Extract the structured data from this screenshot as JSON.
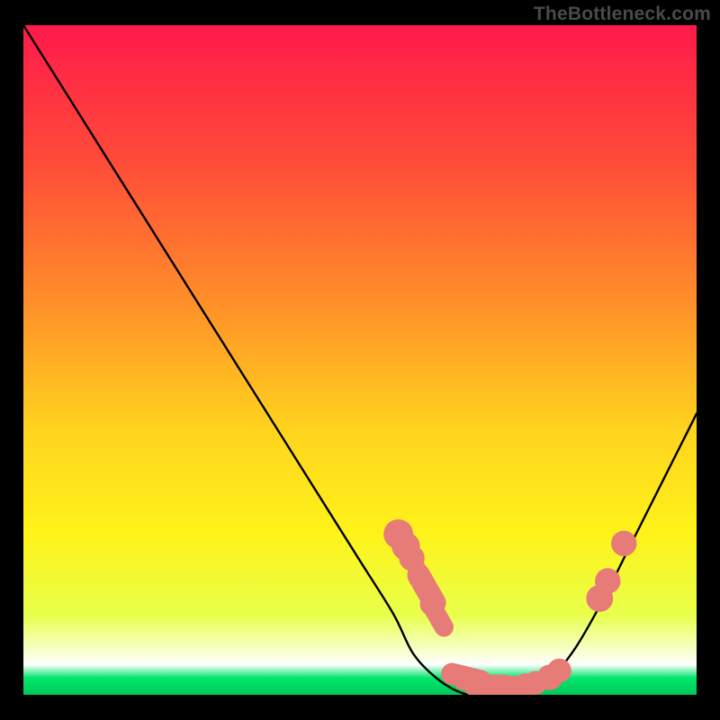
{
  "watermark": "TheBottleneck.com",
  "gradient": {
    "stops": [
      {
        "offset": 0.0,
        "color": "#ff1a4b"
      },
      {
        "offset": 0.2,
        "color": "#ff4a39"
      },
      {
        "offset": 0.4,
        "color": "#ff8a2a"
      },
      {
        "offset": 0.6,
        "color": "#ffd21e"
      },
      {
        "offset": 0.76,
        "color": "#fff31a"
      },
      {
        "offset": 0.88,
        "color": "#e8ff4a"
      },
      {
        "offset": 0.955,
        "color": "#ffffff"
      },
      {
        "offset": 0.975,
        "color": "#00e66b"
      },
      {
        "offset": 1.0,
        "color": "#00c95a"
      }
    ]
  },
  "colors": {
    "curve_stroke": "#000000",
    "marker_fill": "#e77b78",
    "background": "#000000"
  },
  "chart_data": {
    "type": "line",
    "title": "",
    "xlabel": "",
    "ylabel": "",
    "xlim": [
      0,
      100
    ],
    "ylim": [
      0,
      100
    ],
    "note": "Axes are unlabeled percent scales; values estimated from the image.",
    "series": [
      {
        "name": "bottleneck-curve",
        "x": [
          0,
          5,
          10,
          15,
          20,
          25,
          30,
          35,
          40,
          45,
          50,
          55,
          58,
          62,
          66,
          70,
          75,
          78,
          82,
          86,
          90,
          95,
          100
        ],
        "y": [
          100,
          92,
          84,
          76,
          68,
          60,
          52,
          44,
          36,
          28,
          20,
          12,
          6,
          2,
          0,
          0,
          0,
          2,
          7,
          14,
          22,
          32,
          42
        ]
      }
    ],
    "markers": [
      {
        "x": 55.7,
        "y": 24.0,
        "size": 3.6,
        "shape": "circle"
      },
      {
        "x": 56.8,
        "y": 22.2,
        "size": 3.4,
        "shape": "circle"
      },
      {
        "x": 57.7,
        "y": 20.4,
        "size": 3.0,
        "shape": "circle"
      },
      {
        "x": 58.7,
        "y": 18.4,
        "size": 2.8,
        "shape": "pill"
      },
      {
        "x": 59.9,
        "y": 15.8,
        "size": 3.6,
        "shape": "pill"
      },
      {
        "x": 60.8,
        "y": 13.6,
        "size": 3.0,
        "shape": "circle"
      },
      {
        "x": 61.5,
        "y": 11.8,
        "size": 3.0,
        "shape": "pill"
      },
      {
        "x": 65.8,
        "y": 2.6,
        "size": 3.4,
        "shape": "pill"
      },
      {
        "x": 67.5,
        "y": 1.8,
        "size": 3.4,
        "shape": "pill"
      },
      {
        "x": 69.2,
        "y": 1.4,
        "size": 3.4,
        "shape": "pill"
      },
      {
        "x": 71.1,
        "y": 1.2,
        "size": 3.4,
        "shape": "pill"
      },
      {
        "x": 73.0,
        "y": 1.2,
        "size": 3.0,
        "shape": "pill"
      },
      {
        "x": 74.6,
        "y": 1.4,
        "size": 2.8,
        "shape": "circle"
      },
      {
        "x": 76.1,
        "y": 1.8,
        "size": 2.7,
        "shape": "circle"
      },
      {
        "x": 78.2,
        "y": 2.6,
        "size": 3.0,
        "shape": "circle"
      },
      {
        "x": 79.6,
        "y": 3.6,
        "size": 2.8,
        "shape": "circle"
      },
      {
        "x": 85.6,
        "y": 14.4,
        "size": 3.2,
        "shape": "circle"
      },
      {
        "x": 86.8,
        "y": 17.0,
        "size": 3.0,
        "shape": "circle"
      },
      {
        "x": 89.2,
        "y": 22.6,
        "size": 3.0,
        "shape": "circle"
      }
    ]
  }
}
